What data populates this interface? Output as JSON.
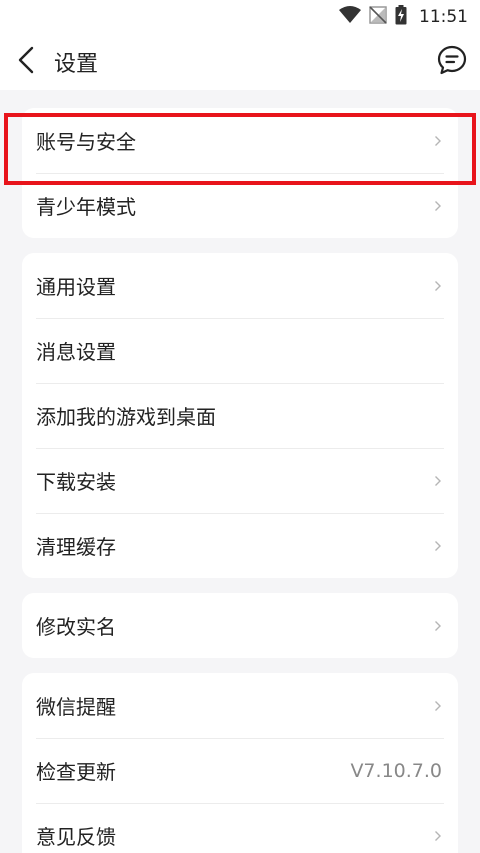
{
  "status_bar": {
    "time": "11:51",
    "icons": [
      "wifi-icon",
      "no-signal-icon",
      "battery-charging-icon"
    ]
  },
  "header": {
    "title": "设置",
    "back_icon": "chevron-left-icon",
    "right_icon": "chat-bubble-icon"
  },
  "groups": [
    {
      "items": [
        {
          "label": "账号与安全",
          "chevron": true
        },
        {
          "label": "青少年模式",
          "chevron": true
        }
      ]
    },
    {
      "items": [
        {
          "label": "通用设置",
          "chevron": true
        },
        {
          "label": "消息设置",
          "chevron": false
        },
        {
          "label": "添加我的游戏到桌面",
          "chevron": false
        },
        {
          "label": "下载安装",
          "chevron": true
        },
        {
          "label": "清理缓存",
          "chevron": true
        }
      ]
    },
    {
      "items": [
        {
          "label": "修改实名",
          "chevron": true
        }
      ]
    },
    {
      "items": [
        {
          "label": "微信提醒",
          "chevron": true
        },
        {
          "label": "检查更新",
          "value": "V7.10.7.0",
          "chevron": false
        },
        {
          "label": "意见反馈",
          "chevron": true
        }
      ]
    }
  ],
  "highlight_color": "#e8141b"
}
